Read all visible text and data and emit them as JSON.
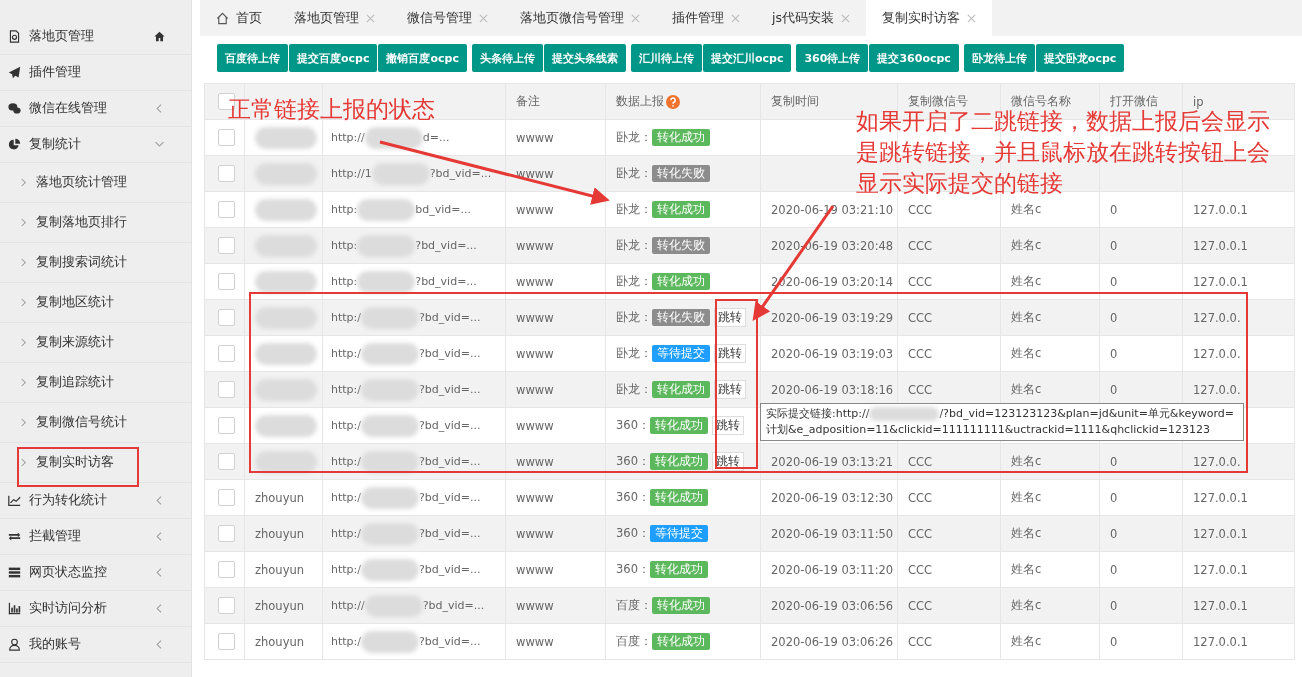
{
  "sidebar": {
    "items": [
      {
        "label": "落地页管理"
      },
      {
        "label": "插件管理"
      },
      {
        "label": "微信在线管理",
        "expanded": false
      },
      {
        "label": "复制统计",
        "expanded": true,
        "children": [
          {
            "label": "落地页统计管理"
          },
          {
            "label": "复制落地页排行"
          },
          {
            "label": "复制搜索词统计"
          },
          {
            "label": "复制地区统计"
          },
          {
            "label": "复制来源统计"
          },
          {
            "label": "复制追踪统计"
          },
          {
            "label": "复制微信号统计"
          },
          {
            "label": "复制实时访客"
          }
        ]
      },
      {
        "label": "行为转化统计",
        "expanded": false
      },
      {
        "label": "拦截管理",
        "expanded": false
      },
      {
        "label": "网页状态监控",
        "expanded": false
      },
      {
        "label": "实时访问分析",
        "expanded": false
      },
      {
        "label": "我的账号",
        "expanded": false
      }
    ]
  },
  "tabs": [
    {
      "label": "首页",
      "selected": false
    },
    {
      "label": "落地页管理",
      "selected": false
    },
    {
      "label": "微信号管理",
      "selected": false
    },
    {
      "label": "落地页微信号管理",
      "selected": false
    },
    {
      "label": "插件管理",
      "selected": false
    },
    {
      "label": "js代码安装",
      "selected": false
    },
    {
      "label": "复制实时访客",
      "selected": true
    }
  ],
  "button_groups": [
    [
      "百度待上传",
      "提交百度ocpc",
      "撤销百度ocpc"
    ],
    [
      "头条待上传",
      "提交头条线索"
    ],
    [
      "汇川待上传",
      "提交汇川ocpc"
    ],
    [
      "360待上传",
      "提交360ocpc"
    ],
    [
      "卧龙待上传",
      "提交卧龙ocpc"
    ]
  ],
  "table": {
    "header_checked": false,
    "columns": [
      "备注",
      "数据上报",
      "复制时间",
      "复制微信号",
      "微信号名称",
      "打开微信",
      "ip"
    ],
    "rows": [
      {
        "checked": false,
        "url_start": "http://",
        "url_end": "d=...",
        "note": "wwww",
        "platform": "卧龙：",
        "status": {
          "text": "转化成功",
          "kind": "success"
        }
      },
      {
        "checked": false,
        "url_start": "http://1",
        "url_end": "?bd_vid=...",
        "note": "wwww",
        "platform": "卧龙：",
        "status": {
          "text": "转化失败",
          "kind": "fail"
        }
      },
      {
        "checked": false,
        "url_start": "http:",
        "url_end": "bd_vid=...",
        "note": "wwww",
        "platform": "卧龙：",
        "status": {
          "text": "转化成功",
          "kind": "success"
        },
        "time": "2020-06-19 03:21:10",
        "wechat": "CCC",
        "name": "姓名c",
        "open": "0",
        "ip": "127.0.0.1"
      },
      {
        "checked": false,
        "url_start": "http:",
        "url_end": "?bd_vid=...",
        "note": "wwww",
        "platform": "卧龙：",
        "status": {
          "text": "转化失败",
          "kind": "fail"
        },
        "time": "2020-06-19 03:20:48",
        "wechat": "CCC",
        "name": "姓名c",
        "open": "0",
        "ip": "127.0.0.1"
      },
      {
        "checked": false,
        "url_start": "http:",
        "url_end": "?bd_vid=...",
        "note": "wwww",
        "platform": "卧龙：",
        "status": {
          "text": "转化成功",
          "kind": "success"
        },
        "time": "2020-06-19 03:20:14",
        "wechat": "CCC",
        "name": "姓名c",
        "open": "0",
        "ip": "127.0.0.1"
      },
      {
        "checked": false,
        "url_start": "http:/",
        "url_end": "?bd_vid=...",
        "note": "wwww",
        "platform": "卧龙：",
        "status": {
          "text": "转化失败",
          "kind": "fail"
        },
        "jump": "跳转",
        "time": "2020-06-19 03:19:29",
        "wechat": "CCC",
        "name": "姓名c",
        "open": "0",
        "ip": "127.0.0."
      },
      {
        "checked": false,
        "url_start": "http:/",
        "url_end": "?bd_vid=...",
        "note": "wwww",
        "platform": "卧龙：",
        "status": {
          "text": "等待提交",
          "kind": "pending"
        },
        "jump": "跳转",
        "time": "2020-06-19 03:19:03",
        "wechat": "CCC",
        "name": "姓名c",
        "open": "0",
        "ip": "127.0.0."
      },
      {
        "checked": false,
        "url_start": "http:/",
        "url_end": "?bd_vid=...",
        "note": "wwww",
        "platform": "卧龙：",
        "status": {
          "text": "转化成功",
          "kind": "success"
        },
        "jump": "跳转",
        "time": "2020-06-19 03:18:16",
        "wechat": "CCC",
        "name": "姓名c",
        "open": "0",
        "ip": "127.0.0."
      },
      {
        "checked": false,
        "url_start": "http:/",
        "url_end": "?bd_vid=...",
        "note": "wwww",
        "platform": "360：",
        "status": {
          "text": "转化成功",
          "kind": "success"
        },
        "jump": "跳转"
      },
      {
        "checked": false,
        "url_start": "http:/",
        "url_end": "?bd_vid=...",
        "note": "wwww",
        "platform": "360：",
        "status": {
          "text": "转化成功",
          "kind": "success"
        },
        "jump": "跳转",
        "time": "2020-06-19 03:13:21",
        "wechat": "CCC",
        "name": "姓名c",
        "open": "0",
        "ip": "127.0.0."
      },
      {
        "checked": false,
        "account": "zhouyun",
        "url_start": "http:/",
        "url_end": "?bd_vid=...",
        "note": "wwww",
        "platform": "360：",
        "status": {
          "text": "转化成功",
          "kind": "success"
        },
        "time": "2020-06-19 03:12:30",
        "wechat": "CCC",
        "name": "姓名c",
        "open": "0",
        "ip": "127.0.0.1"
      },
      {
        "checked": false,
        "account": "zhouyun",
        "url_start": "http:/",
        "url_end": "?bd_vid=...",
        "note": "wwww",
        "platform": "360：",
        "status": {
          "text": "等待提交",
          "kind": "pending"
        },
        "time": "2020-06-19 03:11:50",
        "wechat": "CCC",
        "name": "姓名c",
        "open": "0",
        "ip": "127.0.0.1"
      },
      {
        "checked": false,
        "account": "zhouyun",
        "url_start": "http:/",
        "url_end": "?bd_vid=...",
        "note": "wwww",
        "platform": "360：",
        "status": {
          "text": "转化成功",
          "kind": "success"
        },
        "time": "2020-06-19 03:11:20",
        "wechat": "CCC",
        "name": "姓名c",
        "open": "0",
        "ip": "127.0.0.1"
      },
      {
        "checked": false,
        "account": "zhouyun",
        "url_start": "http://",
        "url_end": "?bd_vid=...",
        "note": "wwww",
        "platform": "百度：",
        "status": {
          "text": "转化成功",
          "kind": "success"
        },
        "time": "2020-06-19 03:06:56",
        "wechat": "CCC",
        "name": "姓名c",
        "open": "0",
        "ip": "127.0.0.1"
      },
      {
        "checked": false,
        "account": "zhouyun",
        "url_start": "http:/",
        "url_end": "?bd_vid=...",
        "note": "wwww",
        "platform": "百度：",
        "status": {
          "text": "转化成功",
          "kind": "success"
        },
        "time": "2020-06-19 03:06:26",
        "wechat": "CCC",
        "name": "姓名c",
        "open": "0",
        "ip": "127.0.0.1"
      }
    ]
  },
  "tooltip": {
    "label": "实际提交链接:http://",
    "link": "/?bd_vid=123123123&plan=jd&unit=单元&keyword=计划&e_adposition=11&clickid=111111111&uctrackid=1111&qhclickid=123123"
  },
  "annotations": [
    "正常链接上报的状态",
    "如果开启了二跳链接，数据上报后会显示是跳转链接，并且鼠标放在跳转按钮上会显示实际提交的链接"
  ]
}
